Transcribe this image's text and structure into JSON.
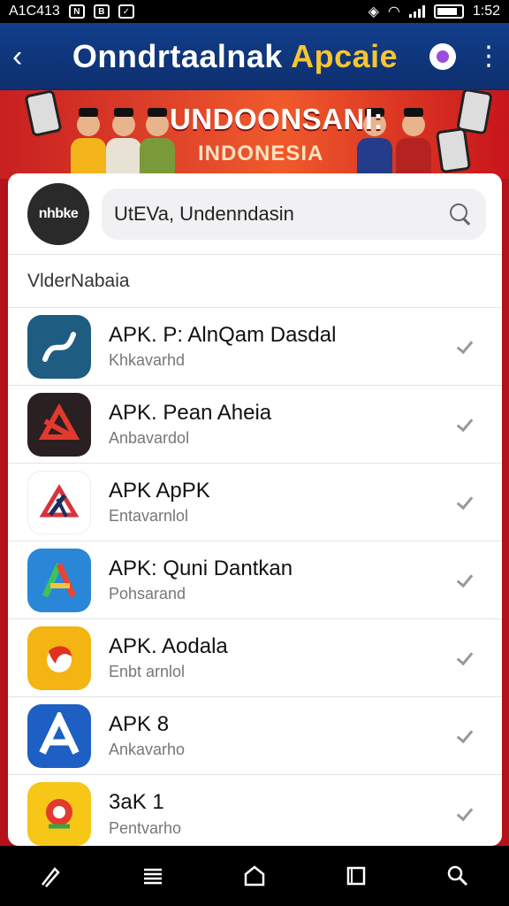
{
  "status_bar": {
    "time_left": "A1C413",
    "badge_1": "N",
    "badge_2": "B",
    "clock": "1:52"
  },
  "app_bar": {
    "title_main": "Onndrtaalnak",
    "title_accent": "Apcaie"
  },
  "banner": {
    "heading": "UNDOONSANI:",
    "subheading": "INDONESIA"
  },
  "search": {
    "avatar_text": "nhbke",
    "value": "UtEVa, Undenndasin"
  },
  "section_label": "VlderNabaia",
  "apps": [
    {
      "name": "APK. P: AlnQam Dasdal",
      "sub": "Khkavarhd",
      "icon": "swoosh-icon",
      "bg": "#1f5c82"
    },
    {
      "name": "APK. Pean Aheia",
      "sub": "Anbavardol",
      "icon": "red-a-icon",
      "bg": "#2b2021"
    },
    {
      "name": "APK ApPK",
      "sub": "Entavarnlol",
      "icon": "triangle-logo-icon",
      "bg": "#ffffff"
    },
    {
      "name": "APK: Quni Dantkan",
      "sub": "Pohsarand",
      "icon": "colored-a-icon",
      "bg": "#2a87d8"
    },
    {
      "name": "APK. Aodala",
      "sub": "Enbt arnlol",
      "icon": "flame-icon",
      "bg": "#f4b412"
    },
    {
      "name": "APK 8",
      "sub": "Ankavarho",
      "icon": "white-a-icon",
      "bg": "#1d5fc3"
    },
    {
      "name": "3aK 1",
      "sub": "Pentvarho",
      "icon": "map-pin-icon",
      "bg": "#f6c716"
    }
  ],
  "nav": [
    "pen-icon",
    "menu-icon",
    "home-icon",
    "square-icon",
    "search-icon"
  ]
}
